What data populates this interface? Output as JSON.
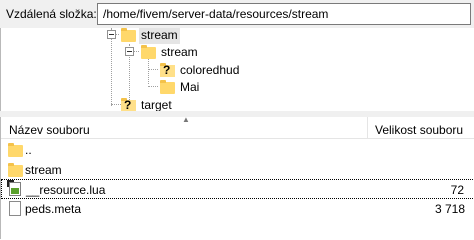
{
  "remote_path": {
    "label": "Vzdálená složka:",
    "value": "/home/fivem/server-data/resources/stream"
  },
  "tree": {
    "nodes": [
      {
        "label": "stream",
        "icon": "folder-icon",
        "selected": true
      },
      {
        "label": "stream",
        "icon": "folder-icon",
        "selected": false
      },
      {
        "label": "coloredhud",
        "icon": "unknown-folder-icon",
        "selected": false
      },
      {
        "label": "Mai",
        "icon": "folder-icon",
        "selected": false
      },
      {
        "label": "target",
        "icon": "unknown-folder-icon",
        "selected": false
      }
    ]
  },
  "file_list": {
    "columns": {
      "name": "Název souboru",
      "size": "Velikost souboru"
    },
    "rows": [
      {
        "name": "..",
        "size": "",
        "icon": "folder-icon"
      },
      {
        "name": "stream",
        "size": "",
        "icon": "folder-icon"
      },
      {
        "name": "__resource.lua",
        "size": "72",
        "icon": "lua-file-icon"
      },
      {
        "name": "peds.meta",
        "size": "3 718",
        "icon": "file-icon"
      }
    ]
  },
  "colors": {
    "folder": "#ffd86b",
    "selection": "#e5e5e5",
    "panel": "#f0f0f0"
  }
}
